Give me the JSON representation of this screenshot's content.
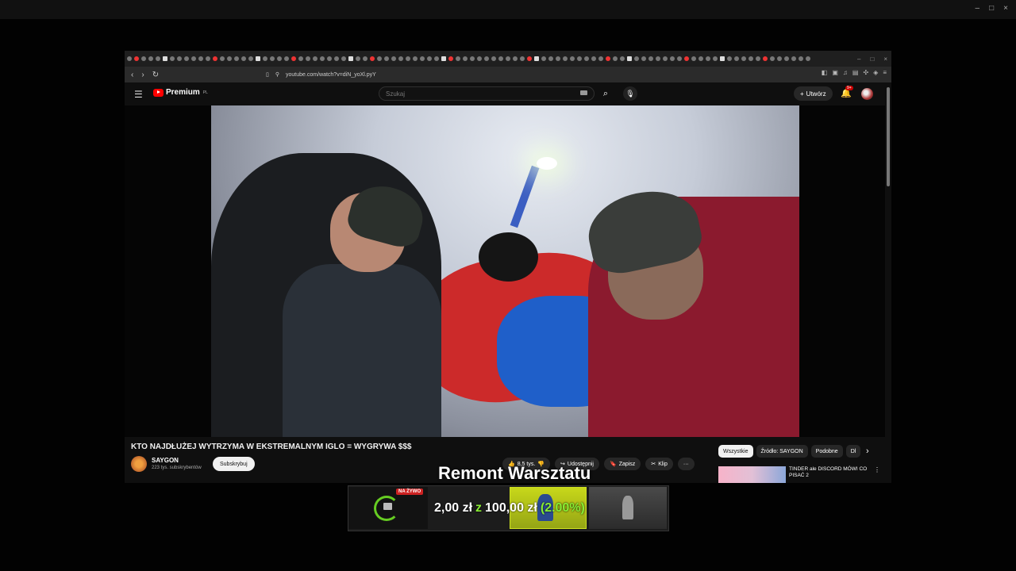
{
  "window": {
    "controls": [
      "–",
      "□",
      "×"
    ]
  },
  "browser": {
    "url": "youtube.com/watch?v=diN_yoXl.pyY",
    "tab_close": "×",
    "nav": {
      "back": "‹",
      "forward": "›",
      "reload": "↻"
    }
  },
  "youtube": {
    "logo_text": "Premium",
    "logo_sup": "PL",
    "search_placeholder": "Szukaj",
    "create_label": "Utwórz",
    "notif_badge": "9+",
    "video_title": "KTO NAJDŁUŻEJ WYTRZYMA W EKSTREMALNYM IGLO = WYGRYWA $$$",
    "channel_name": "SAYGON",
    "channel_subs": "223 tys. subskrybentów",
    "subscribe_label": "Subskrybuj",
    "likes": "8,5 tys.",
    "share_label": "Udostępnij",
    "save_label": "Zapisz",
    "clip_label": "Klip",
    "more_label": "···",
    "chips": [
      "Wszystkie",
      "Źródło: SAYGON",
      "Podobne",
      "Dl"
    ],
    "rec_title": "TINDER ale DISCORD MÓWI CO PISAĆ 2"
  },
  "overlay": {
    "title": "Remont Warsztatu",
    "live_badge": "NA ŻYWO",
    "current": "2,00 zł",
    "of": "z",
    "goal": "100,00 zł",
    "percent": "(2.00%)",
    "progress_fraction": 0.02
  },
  "colors": {
    "youtube_red": "#ff0000",
    "progress_green": "#88ee33",
    "bar_yellow": "#c8d81a"
  }
}
